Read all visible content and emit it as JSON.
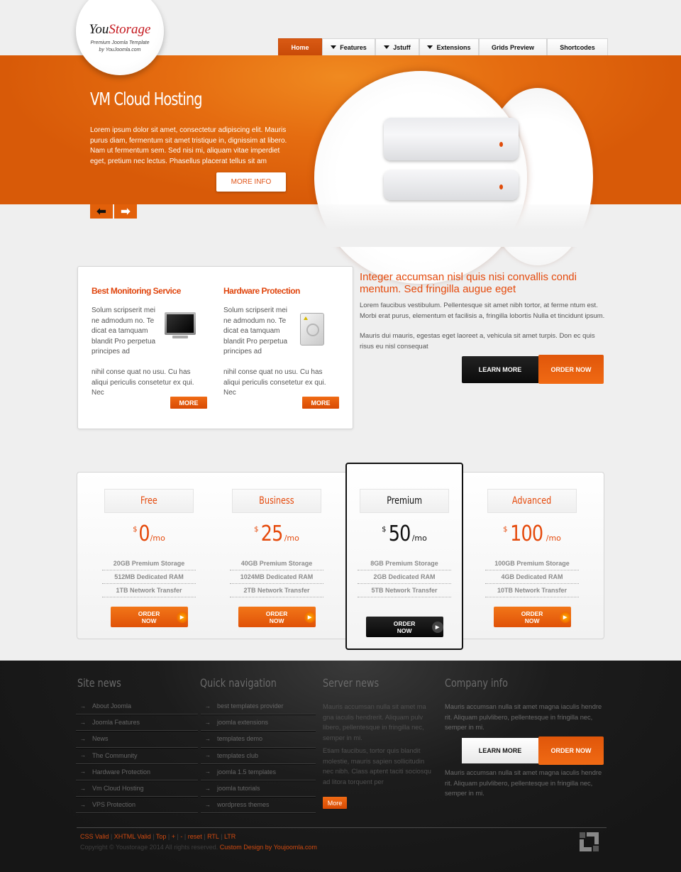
{
  "logo": {
    "brand_part1": "You",
    "brand_part2": "Storage",
    "tagline": "Premium Joomla Template",
    "byline": "by YouJoomla.com"
  },
  "nav": [
    {
      "label": "Home",
      "active": true,
      "dropdown": false
    },
    {
      "label": "Features",
      "dropdown": true
    },
    {
      "label": "Jstuff",
      "dropdown": true
    },
    {
      "label": "Extensions",
      "dropdown": true
    },
    {
      "label": "Grids Preview",
      "dropdown": false
    },
    {
      "label": "Shortcodes",
      "dropdown": false
    }
  ],
  "hero": {
    "title": "VM Cloud Hosting",
    "text": "Lorem ipsum dolor sit amet, consectetur adipiscing elit. Mauris purus diam, fermentum sit amet tristique in, dignissim at libero. Nam ut fermentum sem. Sed nisi mi, aliquam vitae imperdiet eget, pretium nec lectus. Phasellus placerat tellus sit am",
    "button": "MORE INFO",
    "prev_icon": "arrow-left-icon",
    "next_icon": "arrow-right-icon",
    "image": "server-stack-icon"
  },
  "features": [
    {
      "title": "Best Monitoring Service",
      "text1": "Solum scripserit mei ne admodum no. Te dicat ea tamquam blandit Pro perpetua principes ad",
      "text2": "nihil conse quat no usu. Cu has aliqui periculis consetetur ex qui. Nec",
      "button": "MORE",
      "icon": "monitor-icon"
    },
    {
      "title": "Hardware Protection",
      "text1": "Solum scripserit mei ne admodum no. Te dicat ea tamquam blandit Pro perpetua principes ad",
      "text2": "nihil conse quat no usu. Cu has aliqui periculis consetetur ex qui. Nec",
      "button": "MORE",
      "icon": "hard-drive-icon"
    }
  ],
  "intro": {
    "title": "Integer accumsan nisl quis nisi convallis condi mentum. Sed fringilla augue eget",
    "para1": "Lorem faucibus vestibulum. Pellentesque sit amet nibh tortor, at ferme ntum est. Morbi erat purus, elementum et facilisis a, fringilla lobortis Nulla et tincidunt ipsum.",
    "para2": "Mauris dui mauris, egestas eget laoreet a, vehicula sit amet turpis. Don ec quis risus eu nisl consequat",
    "learn_more": "LEARN MORE",
    "order_now": "ORDER NOW"
  },
  "pricing": [
    {
      "name": "Free",
      "currency": "$",
      "amount": "0",
      "period": "/mo",
      "features": [
        "20GB Premium Storage",
        "512MB Dedicated RAM",
        "1TB Network Transfer"
      ],
      "button": "ORDER NOW",
      "highlighted": false
    },
    {
      "name": "Business",
      "currency": "$",
      "amount": "25",
      "period": "/mo",
      "features": [
        "40GB Premium Storage",
        "1024MB Dedicated RAM",
        "2TB Network Transfer"
      ],
      "button": "ORDER NOW",
      "highlighted": false
    },
    {
      "name": "Premium",
      "currency": "$",
      "amount": "50",
      "period": "/mo",
      "features": [
        "8GB Premium Storage",
        "2GB Dedicated RAM",
        "5TB Network Transfer"
      ],
      "button": "ORDER NOW",
      "highlighted": true
    },
    {
      "name": "Advanced",
      "currency": "$",
      "amount": "100",
      "period": "/mo",
      "features": [
        "100GB Premium Storage",
        "4GB Dedicated RAM",
        "10TB Network Transfer"
      ],
      "button": "ORDER NOW",
      "highlighted": false
    }
  ],
  "footer": {
    "site_news": {
      "title": "Site news",
      "items": [
        "About Joomla",
        "Joomla Features",
        "News",
        "The Community",
        "Hardware Protection",
        "Vm Cloud Hosting",
        "VPS Protection"
      ]
    },
    "quick_nav": {
      "title": "Quick navigation",
      "items": [
        "best templates provider",
        "joomla extensions",
        "templates demo",
        "templates club",
        "joomla 1.5 templates",
        "joomla tutorials",
        "wordpress themes"
      ]
    },
    "server_news": {
      "title": "Server news",
      "para1": "Mauris accumsan nulla sit amet ma gna iaculis hendrerit. Aliquam pulv libero, pellentesque in fringilla nec, semper in mi.",
      "para2": "Etiam faucibus, tortor quis blandit molestie, mauris sapien sollicitudin nec nibh. Class aptent taciti sociosqu ad litora torquent per",
      "button": "More"
    },
    "company_info": {
      "title": "Company info",
      "para1": "Mauris accumsan nulla sit amet magna iaculis hendre rit. Aliquam pulvlibero, pellentesque in fringilla nec, semper in mi.",
      "learn_more": "LEARN MORE",
      "order_now": "ORDER NOW",
      "para2": "Mauris accumsan nulla sit amet magna iaculis hendre rit. Aliquam pulvlibero, pellentesque in fringilla nec, semper in mi."
    },
    "links": [
      "CSS Valid",
      "XHTML Valid",
      "Top",
      "+",
      "-",
      "reset",
      "RTL",
      "LTR"
    ],
    "copyright": "Copyright © Youstorage 2014 All rights reserved.",
    "credit": "Custom Design by Youjoomla.com",
    "corner_icon": "youjoomla-logo-icon"
  },
  "colors": {
    "accent": "#e2600a",
    "accent_text": "#e54a0c",
    "dark": "#161616"
  }
}
